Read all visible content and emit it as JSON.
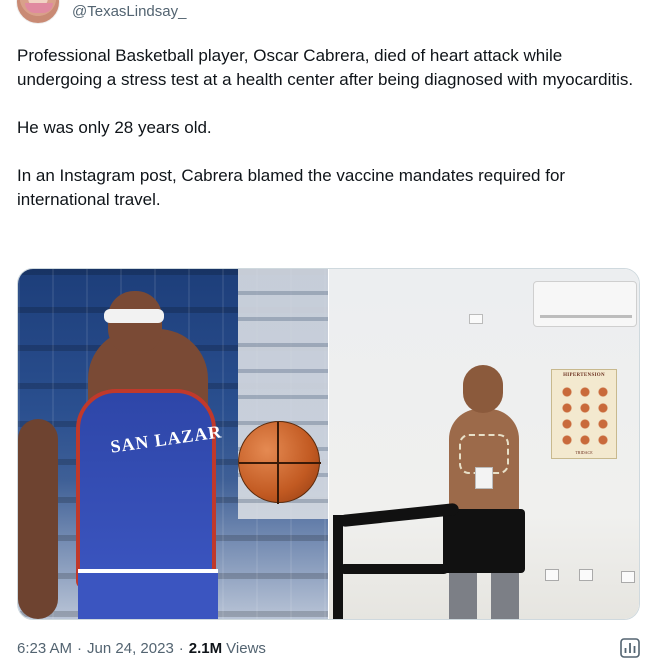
{
  "author": {
    "handle": "@TexasLindsay_"
  },
  "tweet": {
    "paragraphs": [
      "Professional Basketball player, Oscar Cabrera, died of heart attack while undergoing a stress test at a health center after being diagnosed with myocarditis.",
      "He was only 28 years old.",
      "In an Instagram post, Cabrera blamed the vaccine mandates required for international travel."
    ]
  },
  "media": {
    "left_photo": {
      "jersey_text": "SAN LAZAR"
    },
    "right_photo": {
      "poster_title": "HIPERTENSION",
      "poster_footer": "TRIDACE"
    }
  },
  "footer": {
    "time": "6:23 AM",
    "separator": "·",
    "date": "Jun 24, 2023",
    "views_count": "2.1M",
    "views_label": "Views"
  },
  "icons": {
    "stats": "view-stats-icon"
  }
}
